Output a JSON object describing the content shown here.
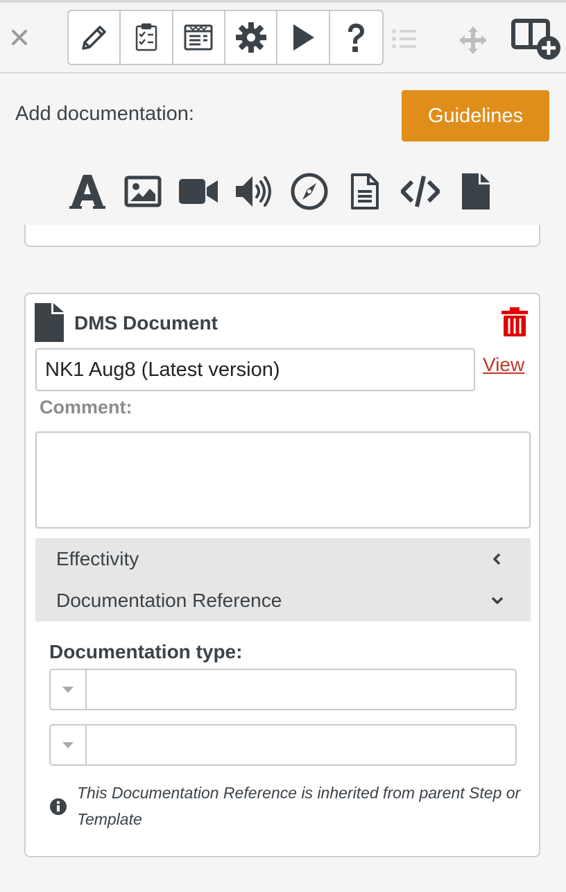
{
  "toolbar": {
    "close_icon": "close-icon",
    "tools": [
      {
        "name": "edit-tool",
        "icon": "pencil-icon"
      },
      {
        "name": "checklist-tool",
        "icon": "clipboard-checklist-icon"
      },
      {
        "name": "form-tool",
        "icon": "form-list-icon"
      },
      {
        "name": "settings-tool",
        "icon": "gear-icon"
      },
      {
        "name": "run-tool",
        "icon": "play-icon"
      },
      {
        "name": "help-tool",
        "icon": "question-icon"
      }
    ],
    "list_icon": "list-icon",
    "move_icon": "move-icon",
    "layout_add_icon": "layout-add-icon"
  },
  "add_documentation": {
    "label": "Add documentation:",
    "guidelines_label": "Guidelines",
    "guidelines_color": "#e08e1b",
    "types": [
      "text-icon",
      "image-icon",
      "video-icon",
      "audio-icon",
      "compass-icon",
      "document-icon",
      "code-icon",
      "file-icon"
    ]
  },
  "dms_card": {
    "title": "DMS Document",
    "title_icon": "file-icon",
    "delete_icon": "trash-icon",
    "delete_color": "#e00000",
    "document_value": "NK1 Aug8 (Latest version)",
    "view_label": "View",
    "comment_label": "Comment:",
    "comment_value": "",
    "accordion": [
      {
        "label": "Effectivity",
        "state": "collapsed",
        "icon": "chevron-left-icon"
      },
      {
        "label": "Documentation Reference",
        "state": "expanded",
        "icon": "chevron-down-icon"
      }
    ],
    "documentation_type_label": "Documentation type:",
    "selects": [
      {
        "value": ""
      },
      {
        "value": ""
      }
    ],
    "info_text": "This Documentation Reference is inherited from parent Step or Template"
  }
}
